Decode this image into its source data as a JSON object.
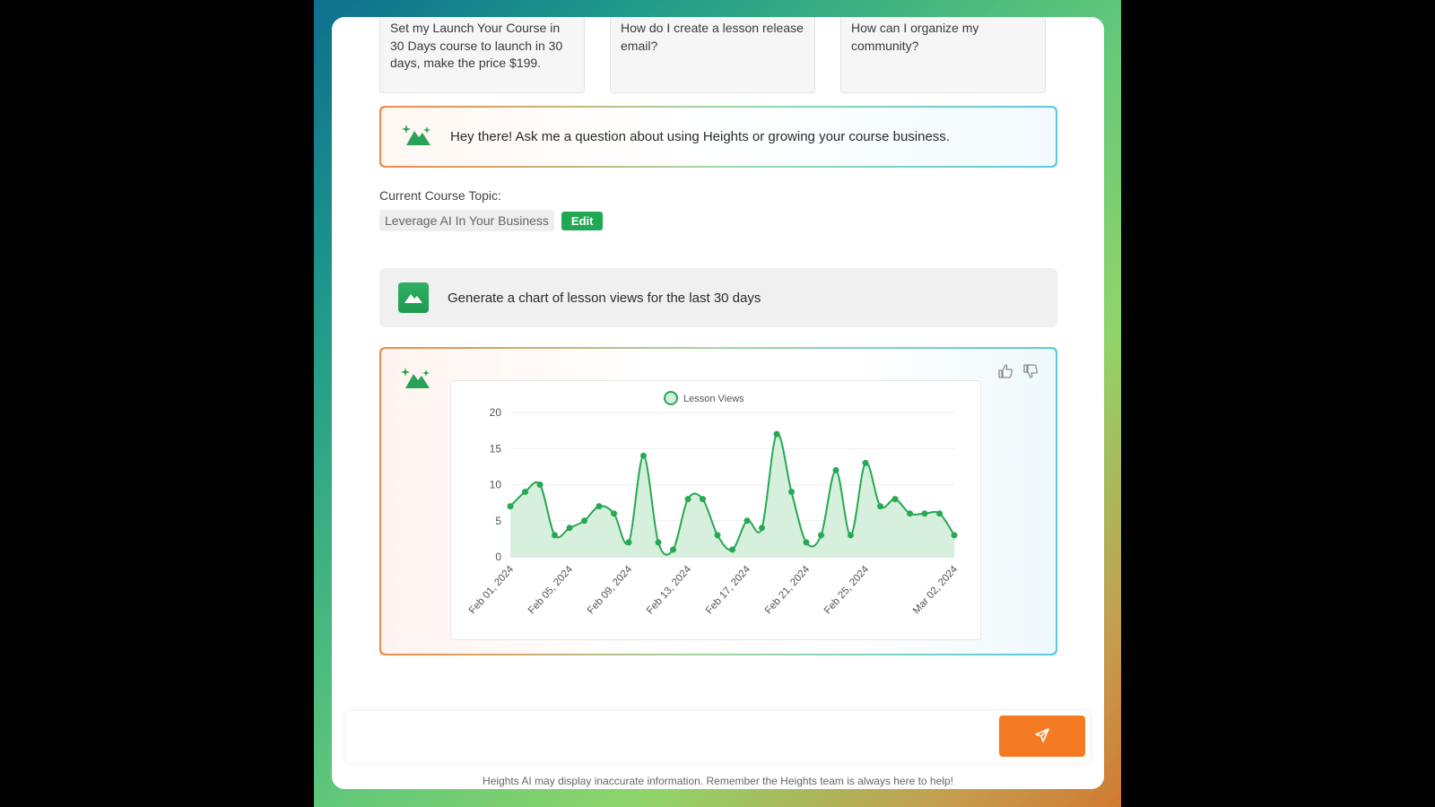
{
  "suggestions": [
    {
      "text": "Set my Launch Your Course in 30 Days course to launch in 30 days, make the price $199."
    },
    {
      "text": "How do I create a lesson release email?"
    },
    {
      "text": "How can I organize my community?"
    }
  ],
  "greeting": {
    "text": "Hey there! Ask me a question about using Heights or growing your course business."
  },
  "topic": {
    "label": "Current Course Topic:",
    "value": "Leverage AI In Your Business",
    "edit_label": "Edit"
  },
  "user_prompt": {
    "text": "Generate a chart of lesson views for the last 30 days"
  },
  "chat": {
    "placeholder": ""
  },
  "disclaimer": "Heights AI may display inaccurate information. Remember the Heights team is always here to help!",
  "colors": {
    "accent_green": "#22a755",
    "send_orange": "#f47a23"
  },
  "icons": {
    "ai": "sparkle-mountain-icon",
    "user": "mountain-icon",
    "like": "thumbs-up-icon",
    "dislike": "thumbs-down-icon",
    "send": "paper-plane-icon"
  },
  "chart_data": {
    "type": "area",
    "legend": [
      "Lesson Views"
    ],
    "legend_position": "top",
    "grid": true,
    "ylim": [
      0,
      20
    ],
    "yticks": [
      "0",
      "5",
      "10",
      "15",
      "20"
    ],
    "x_tick_labels": [
      "Feb 01, 2024",
      "Feb 05, 2024",
      "Feb 09, 2024",
      "Feb 13, 2024",
      "Feb 17, 2024",
      "Feb 21, 2024",
      "Feb 25, 2024",
      "Mar 02, 2024"
    ],
    "series": [
      {
        "name": "Lesson Views",
        "color": "#27a853",
        "x": [
          "Feb 01",
          "Feb 02",
          "Feb 03",
          "Feb 04",
          "Feb 05",
          "Feb 06",
          "Feb 07",
          "Feb 08",
          "Feb 09",
          "Feb 10",
          "Feb 11",
          "Feb 12",
          "Feb 13",
          "Feb 14",
          "Feb 15",
          "Feb 16",
          "Feb 17",
          "Feb 18",
          "Feb 19",
          "Feb 20",
          "Feb 21",
          "Feb 22",
          "Feb 23",
          "Feb 24",
          "Feb 25",
          "Feb 26",
          "Feb 27",
          "Feb 28",
          "Feb 29",
          "Mar 01",
          "Mar 02"
        ],
        "values": [
          7,
          9,
          10,
          3,
          4,
          5,
          7,
          6,
          2,
          14,
          2,
          1,
          8,
          8,
          3,
          1,
          5,
          4,
          17,
          9,
          2,
          3,
          12,
          3,
          13,
          7,
          8,
          6,
          6,
          6,
          3
        ]
      }
    ]
  }
}
